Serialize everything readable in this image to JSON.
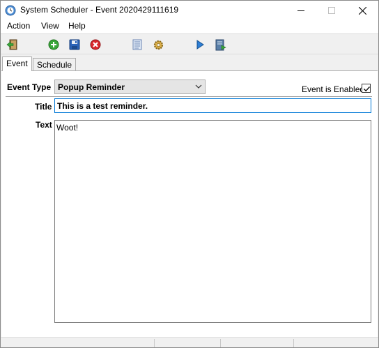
{
  "window": {
    "title": "System Scheduler - Event 2020429111619",
    "icon": "clock-icon"
  },
  "menu": {
    "items": [
      {
        "label": "Action"
      },
      {
        "label": "View"
      },
      {
        "label": "Help"
      }
    ]
  },
  "toolbar": {
    "buttons": [
      {
        "icon": "exit-icon"
      },
      {
        "icon": "add-icon"
      },
      {
        "icon": "save-icon"
      },
      {
        "icon": "delete-icon"
      },
      {
        "icon": "list-icon"
      },
      {
        "icon": "settings-gear-icon"
      },
      {
        "icon": "run-icon"
      },
      {
        "icon": "export-icon"
      }
    ]
  },
  "tabs": [
    {
      "label": "Event",
      "active": true
    },
    {
      "label": "Schedule",
      "active": false
    }
  ],
  "event": {
    "event_type_label": "Event Type",
    "event_type_value": "Popup Reminder",
    "enabled_label": "Event is Enabled",
    "enabled": true,
    "title_label": "Title",
    "title_value": "This is a test reminder.",
    "text_label": "Text",
    "text_value": "Woot!"
  },
  "colors": {
    "focus_border": "#0078d7",
    "add_green": "#3aa63a",
    "delete_red": "#d9282d",
    "save_blue": "#2a62b8"
  }
}
